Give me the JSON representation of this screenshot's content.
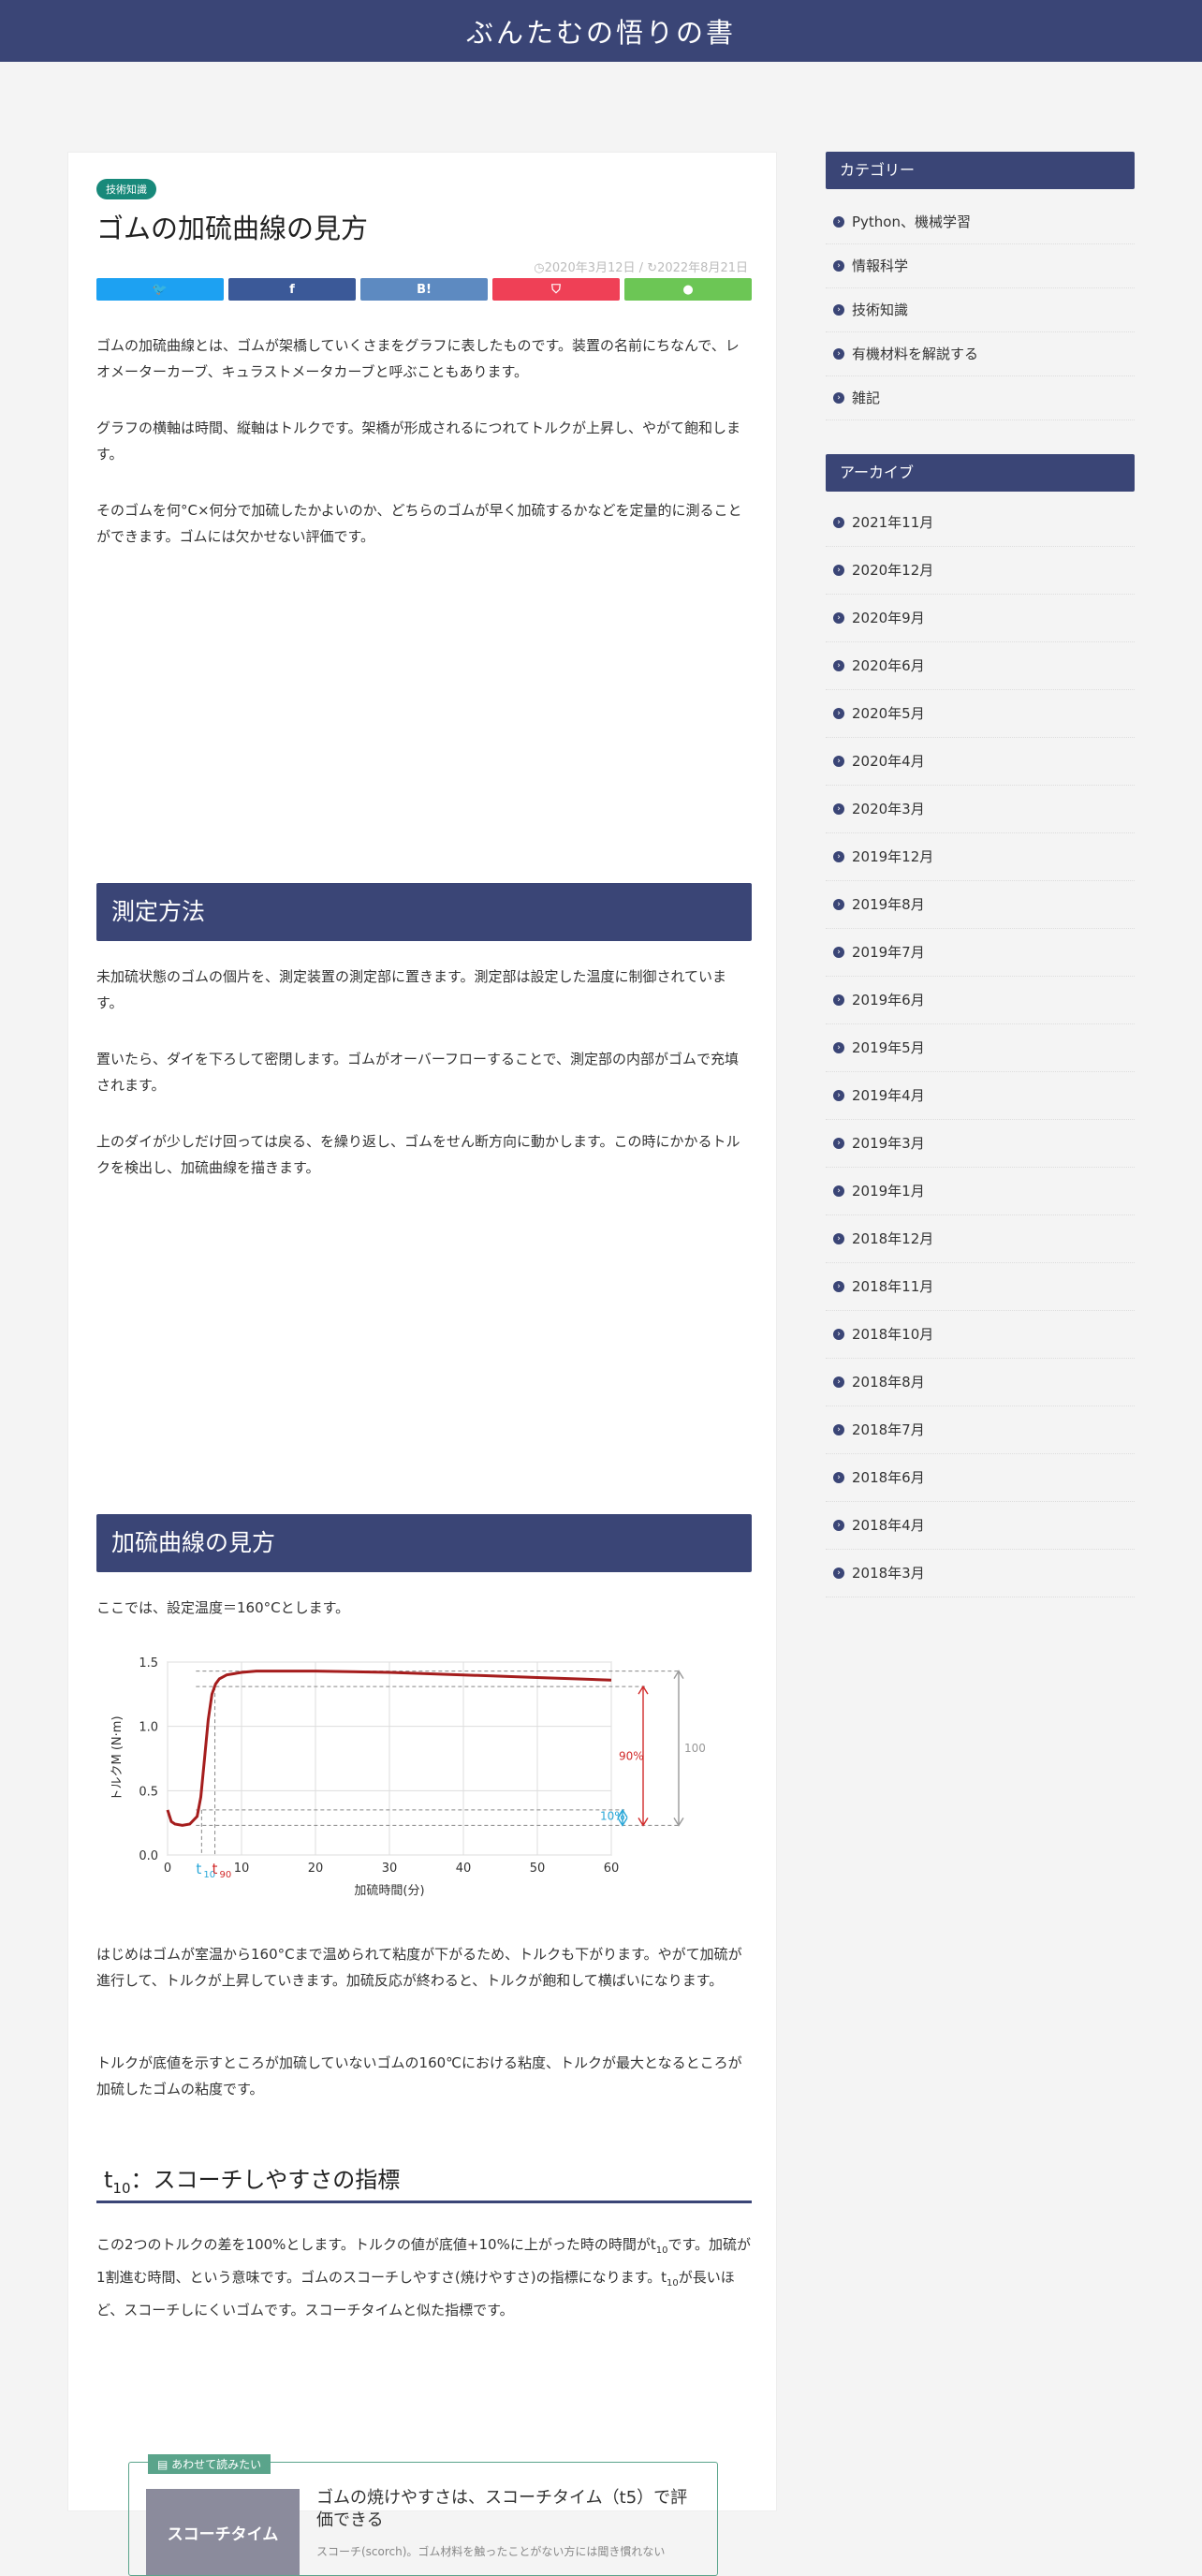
{
  "site": {
    "title": "ぶんたむの悟りの書"
  },
  "post": {
    "category": "技術知識",
    "title": "ゴムの加硫曲線の見方",
    "posted": "2020年3月12日",
    "updated": "2022年8月21日",
    "share": {
      "twitter": "🐦",
      "facebook": "f",
      "hatena": "B!",
      "pocket": "⛉",
      "line": "●"
    },
    "p1": "ゴムの加硫曲線とは、ゴムが架橋していくさまをグラフに表したものです。装置の名前にちなんで、レオメーターカーブ、キュラストメータカーブと呼ぶこともあります。",
    "p2": "グラフの横軸は時間、縦軸はトルクです。架橋が形成されるにつれてトルクが上昇し、やがて飽和します。",
    "p3": "そのゴムを何°C×何分で加硫したかよいのか、どちらのゴムが早く加硫するかなどを定量的に測ることができます。ゴムには欠かせない評価です。",
    "h2_1": "測定方法",
    "p4": "未加硫状態のゴムの個片を、測定装置の測定部に置きます。測定部は設定した温度に制御されています。",
    "p5": "置いたら、ダイを下ろして密閉します。ゴムがオーバーフローすることで、測定部の内部がゴムで充填されます。",
    "p6": "上のダイが少しだけ回っては戻る、を繰り返し、ゴムをせん断方向に動かします。この時にかかるトルクを検出し、加硫曲線を描きます。",
    "h2_2": "加硫曲線の見方",
    "p7": "ここでは、設定温度＝160°Cとします。",
    "p8": "はじめはゴムが室温から160°Cまで温められて粘度が下がるため、トルクも下がります。やがて加硫が進行して、トルクが上昇していきます。加硫反応が終わると、トルクが飽和して横ばいになります。",
    "p9": "トルクが底値を示すところが加硫していないゴムの160℃における粘度、トルクが最大となるところが加硫したゴムの粘度です。",
    "h3_prefix": "t",
    "h3_sub": "10",
    "h3_rest": "：スコーチしやすさの指標",
    "p10a": "この2つのトルクの差を100%とします。トルクの値が底値+10%に上がった時の時間がt",
    "p10b": "10",
    "p10c": "です。加硫が1割進む時間、という意味です。ゴムのスコーチしやすさ(焼けやすさ)の指標になります。t",
    "p10d": "10",
    "p10e": "が長いほど、スコーチしにくいゴムです。スコーチタイムと似た指標です。",
    "related": {
      "tag": "あわせて読みたい",
      "thumb": "スコーチタイム",
      "title": "ゴムの焼けやすさは、スコーチタイム（t5）で評価できる",
      "desc": "スコーチ(scorch)。ゴム材料を触ったことがない方には聞き慣れない"
    }
  },
  "sidebar": {
    "categories_title": "カテゴリー",
    "categories": [
      "Python、機械学習",
      "情報科学",
      "技術知識",
      "有機材料を解説する",
      "雑記"
    ],
    "archive_title": "アーカイブ",
    "archives": [
      "2021年11月",
      "2020年12月",
      "2020年9月",
      "2020年6月",
      "2020年5月",
      "2020年4月",
      "2020年3月",
      "2019年12月",
      "2019年8月",
      "2019年7月",
      "2019年6月",
      "2019年5月",
      "2019年4月",
      "2019年3月",
      "2019年1月",
      "2018年12月",
      "2018年11月",
      "2018年10月",
      "2018年8月",
      "2018年7月",
      "2018年6月",
      "2018年4月",
      "2018年3月"
    ]
  },
  "chart_data": {
    "type": "line",
    "xlabel": "加硫時間(分)",
    "ylabel": "トルクM (N·m)",
    "xlim": [
      0,
      60
    ],
    "ylim": [
      0,
      1.5
    ],
    "xticks": [
      0,
      10,
      20,
      30,
      40,
      50,
      60
    ],
    "yticks": [
      "0.0",
      "0.5",
      "1.0",
      "1.5"
    ],
    "grid": true,
    "line_color": "#a51d1d",
    "x": [
      0,
      0.5,
      1,
      2,
      3,
      4,
      4.5,
      5,
      5.5,
      6,
      6.5,
      7,
      8,
      9,
      10,
      12,
      15,
      20,
      30,
      40,
      50,
      60
    ],
    "y": [
      0.35,
      0.26,
      0.24,
      0.23,
      0.24,
      0.3,
      0.45,
      0.75,
      1.05,
      1.25,
      1.33,
      1.37,
      1.4,
      1.41,
      1.42,
      1.43,
      1.43,
      1.43,
      1.42,
      1.4,
      1.38,
      1.36
    ],
    "t10": 4.6,
    "t90": 6.4,
    "t10_label": "t",
    "t10_sub": "10",
    "t90_label": "t",
    "t90_sub": "90",
    "min_torque": 0.23,
    "max_torque": 1.43,
    "label_90": "90%",
    "label_100": "100%",
    "label_10": "10%",
    "color_90": "#d12a2a",
    "color_10": "#29a7d8",
    "color_100": "#999999"
  }
}
